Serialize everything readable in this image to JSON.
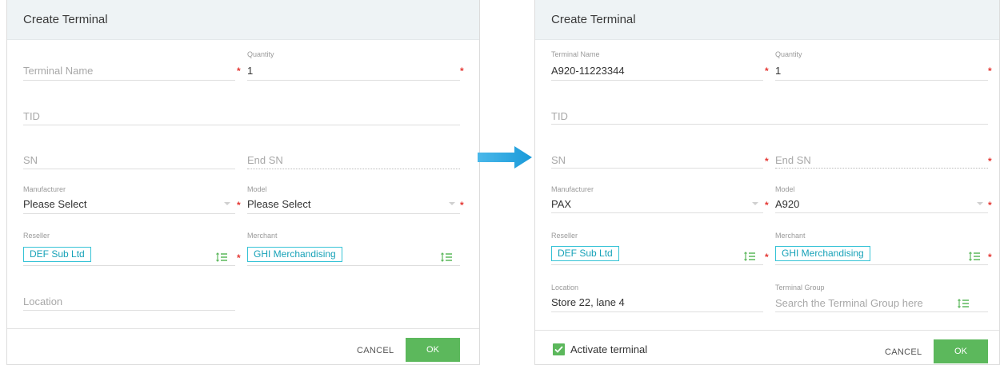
{
  "left": {
    "title": "Create Terminal",
    "terminal_name": {
      "placeholder": "Terminal Name"
    },
    "quantity": {
      "label": "Quantity",
      "value": "1"
    },
    "tid": {
      "placeholder": "TID"
    },
    "sn": {
      "placeholder": "SN"
    },
    "end_sn": {
      "placeholder": "End SN"
    },
    "manufacturer": {
      "label": "Manufacturer",
      "value": "Please Select"
    },
    "model": {
      "label": "Model",
      "value": "Please Select"
    },
    "reseller": {
      "label": "Reseller",
      "value": "DEF Sub Ltd"
    },
    "merchant": {
      "label": "Merchant",
      "value": "GHI Merchandising"
    },
    "location": {
      "placeholder": "Location"
    },
    "cancel_label": "CANCEL",
    "ok_label": "OK"
  },
  "right": {
    "title": "Create Terminal",
    "terminal_name": {
      "label": "Terminal Name",
      "value": "A920-11223344"
    },
    "quantity": {
      "label": "Quantity",
      "value": "1"
    },
    "tid": {
      "placeholder": "TID"
    },
    "sn": {
      "placeholder": "SN"
    },
    "end_sn": {
      "placeholder": "End SN"
    },
    "manufacturer": {
      "label": "Manufacturer",
      "value": "PAX"
    },
    "model": {
      "label": "Model",
      "value": "A920"
    },
    "reseller": {
      "label": "Reseller",
      "value": "DEF Sub Ltd"
    },
    "merchant": {
      "label": "Merchant",
      "value": "GHI Merchandising"
    },
    "location": {
      "label": "Location",
      "value": "Store 22, lane 4"
    },
    "terminal_group": {
      "label": "Terminal Group",
      "placeholder": "Search the Terminal Group here"
    },
    "activate_label": "Activate terminal",
    "cancel_label": "CANCEL",
    "ok_label": "OK"
  },
  "colors": {
    "accent_teal": "#17a2b8",
    "ok_green": "#5cb85c",
    "required_red": "#e53935",
    "arrow_blue": "#1fa3e0",
    "header_bg": "#eef3f5"
  },
  "icons": {
    "list_icon": "sort-list-icon",
    "dropdown": "chevron-down-icon",
    "arrow": "arrow-right-icon",
    "check": "check-icon"
  }
}
